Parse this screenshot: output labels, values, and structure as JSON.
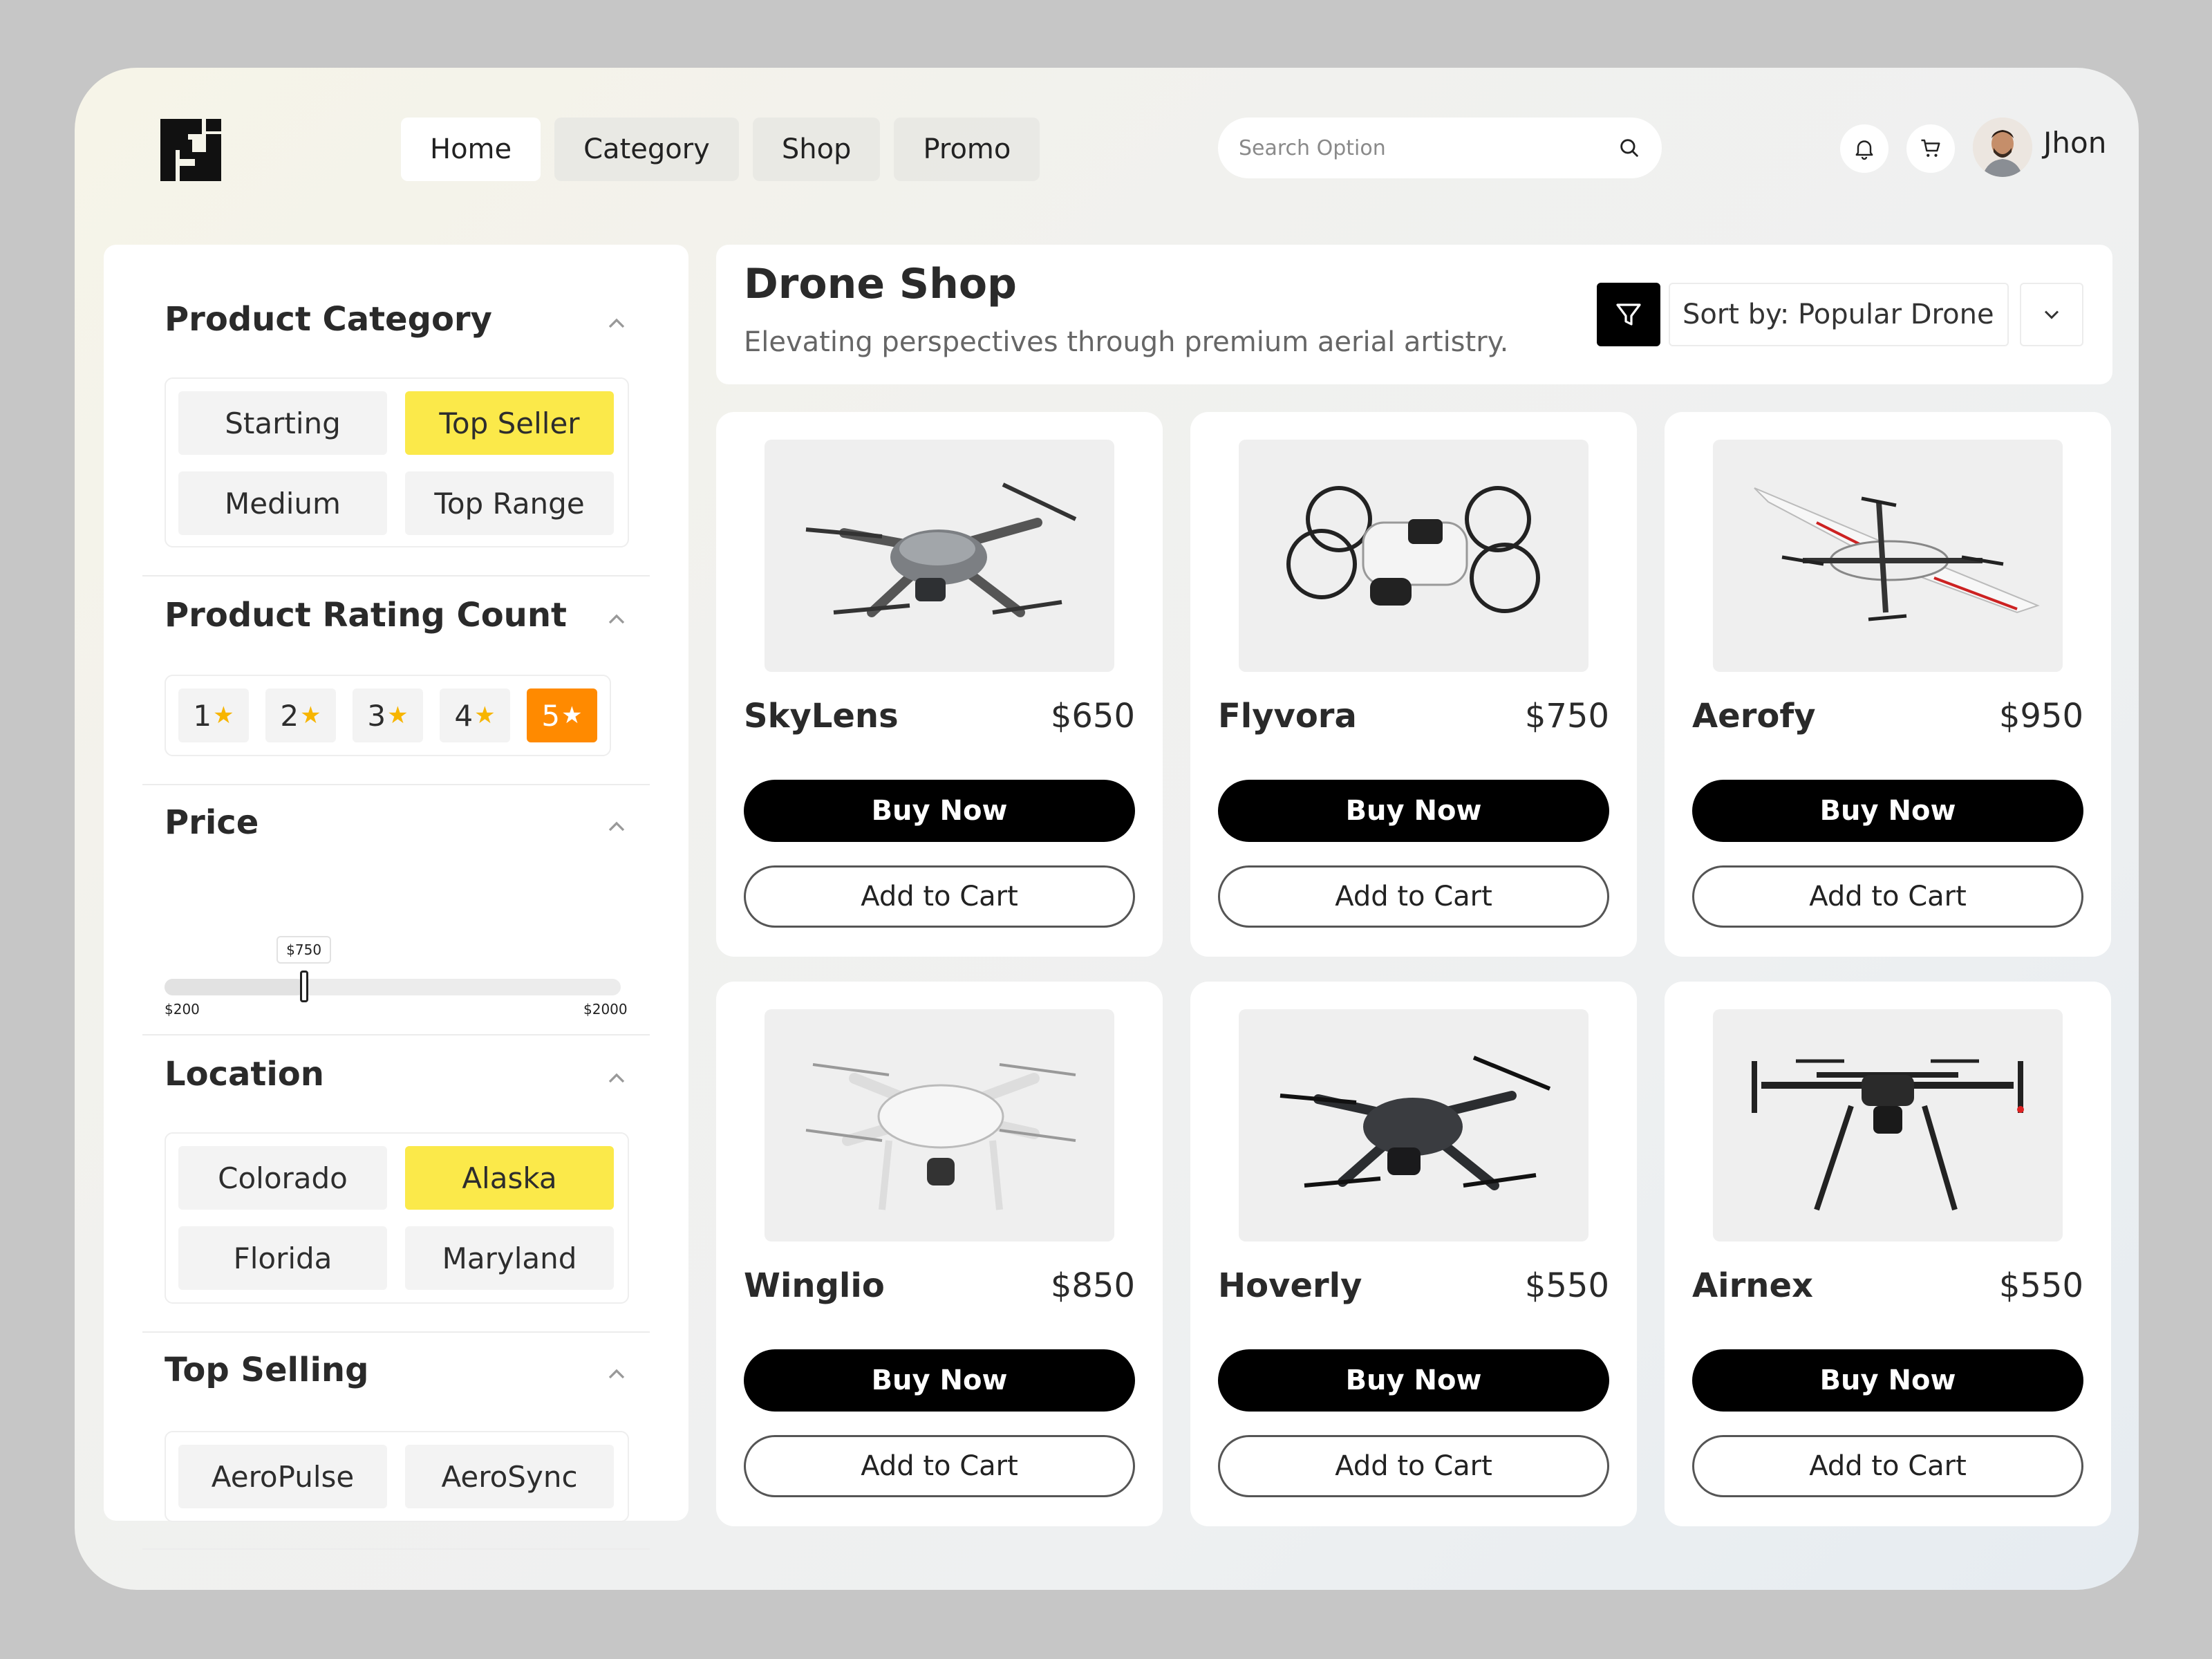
{
  "nav": {
    "items": [
      "Home",
      "Category",
      "Shop",
      "Promo"
    ]
  },
  "search": {
    "placeholder": "Search Option"
  },
  "user": {
    "name": "Jhon"
  },
  "filters": {
    "category": {
      "title": "Product Category",
      "options": [
        "Starting",
        "Top Seller",
        "Medium",
        "Top Range"
      ],
      "selected": "Top Seller"
    },
    "rating": {
      "title": "Product Rating Count",
      "options": [
        "1",
        "2",
        "3",
        "4",
        "5"
      ],
      "star": "★",
      "selected": "5"
    },
    "price": {
      "title": "Price",
      "min_label": "$200",
      "max_label": "$2000",
      "value_label": "$750",
      "min": 200,
      "max": 2000,
      "value": 750
    },
    "location": {
      "title": "Location",
      "options": [
        "Colorado",
        "Alaska",
        "Florida",
        "Maryland"
      ],
      "selected": "Alaska"
    },
    "top_selling": {
      "title": "Top Selling",
      "options": [
        "AeroPulse",
        "AeroSync"
      ]
    }
  },
  "header": {
    "title": "Drone Shop",
    "subtitle": "Elevating perspectives through premium aerial artistry.",
    "sort_label": "Sort by: Popular Drone"
  },
  "products": [
    {
      "name": "SkyLens",
      "price": "$650",
      "buy_label": "Buy Now",
      "cart_label": "Add to Cart"
    },
    {
      "name": "Flyvora",
      "price": "$750",
      "buy_label": "Buy Now",
      "cart_label": "Add to Cart"
    },
    {
      "name": "Aerofy",
      "price": "$950",
      "buy_label": "Buy Now",
      "cart_label": "Add to Cart"
    },
    {
      "name": "Winglio",
      "price": "$850",
      "buy_label": "Buy Now",
      "cart_label": "Add to Cart"
    },
    {
      "name": "Hoverly",
      "price": "$550",
      "buy_label": "Buy Now",
      "cart_label": "Add to Cart"
    },
    {
      "name": "Airnex",
      "price": "$550",
      "buy_label": "Buy Now",
      "cart_label": "Add to Cart"
    }
  ],
  "colors": {
    "accent_yellow": "#fbe94a",
    "accent_orange": "#ff8a00",
    "primary_button": "#000000"
  },
  "icons": {
    "logo": "brand-logo-icon",
    "search": "search-icon",
    "bell": "bell-icon",
    "cart": "cart-icon",
    "filter": "filter-icon",
    "chevron_down": "chevron-down-icon",
    "chevron_up": "chevron-up-icon"
  }
}
